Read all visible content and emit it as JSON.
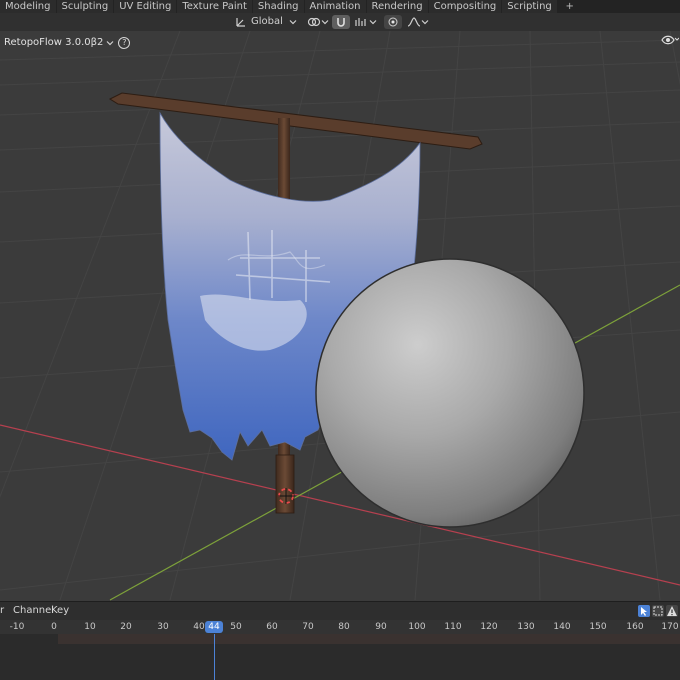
{
  "workspace_tabs": [
    "Modeling",
    "Sculpting",
    "UV Editing",
    "Texture Paint",
    "Shading",
    "Animation",
    "Rendering",
    "Compositing",
    "Scripting",
    "+"
  ],
  "header": {
    "transform_orientation": "Global",
    "pivot_icon": "transform-pivot-icon",
    "snap_icon": "snap-magnet-icon",
    "proportional_icon": "proportional-edit-icon",
    "falloff_icon": "falloff-curve-icon"
  },
  "addon_label": "RetopoFlow 3.0.0β2",
  "help_glyph": "?",
  "timeline": {
    "menus": [
      "r",
      "Channel",
      "Key"
    ],
    "current_frame": "44",
    "ticks": [
      "-10",
      "0",
      "10",
      "20",
      "30",
      "40",
      "50",
      "60",
      "70",
      "80",
      "90",
      "100",
      "110",
      "120",
      "130",
      "140",
      "150",
      "160",
      "170"
    ]
  },
  "colors": {
    "accent": "#4c82d6",
    "x_axis": "#b6404f",
    "y_axis": "#7da13a",
    "viewport_bg": "#3b3b3b"
  }
}
